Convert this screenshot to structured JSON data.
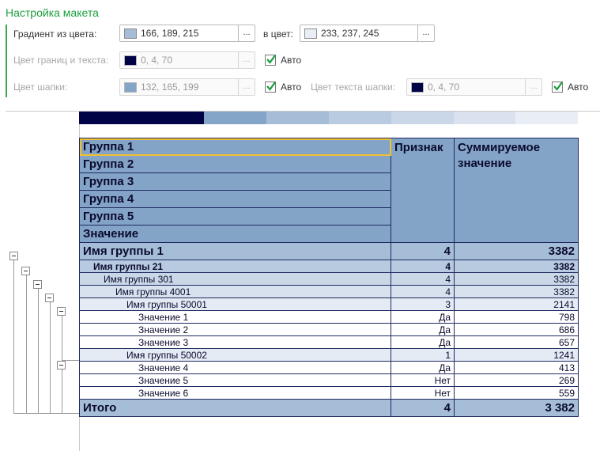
{
  "settings": {
    "title": "Настройка макета",
    "gradient_from_label": "Градиент из цвета:",
    "gradient_from_value": "166, 189, 215",
    "gradient_from_color": "#a6bdd7",
    "gradient_to_label": "в цвет:",
    "gradient_to_value": "233, 237, 245",
    "gradient_to_color": "#e9edf5",
    "border_text_label": "Цвет границ и текста:",
    "border_text_value": "0, 4, 70",
    "border_text_color": "#000446",
    "header_color_label": "Цвет шапки:",
    "header_color_value": "132, 165, 199",
    "header_color_color": "#84a5c7",
    "header_text_label": "Цвет текста шапки:",
    "header_text_value": "0, 4, 70",
    "header_text_color": "#000446",
    "dots": "...",
    "auto_label": "Авто",
    "auto_checked": true
  },
  "gradient_bar": [
    "#000446",
    "#84a5c7",
    "#a6bdd7",
    "#b9cbe0",
    "#cad7e8",
    "#d9e2ee",
    "#e9edf5"
  ],
  "table": {
    "header": {
      "groups": [
        "Группа 1",
        "Группа 2",
        "Группа 3",
        "Группа 4",
        "Группа 5",
        "Значение"
      ],
      "col_sign": "Признак",
      "col_sum": "Суммируемое значение"
    },
    "rows": [
      {
        "name": "Имя группы 1",
        "sign": "4",
        "sum": "3382"
      },
      {
        "name": "Имя группы 21",
        "sign": "4",
        "sum": "3382"
      },
      {
        "name": "Имя группы 301",
        "sign": "4",
        "sum": "3382"
      },
      {
        "name": "Имя группы 4001",
        "sign": "4",
        "sum": "3382"
      },
      {
        "name": "Имя группы 50001",
        "sign": "3",
        "sum": "2141"
      },
      {
        "name": "Значение 1",
        "sign": "Да",
        "sum": "798"
      },
      {
        "name": "Значение 2",
        "sign": "Да",
        "sum": "686"
      },
      {
        "name": "Значение 3",
        "sign": "Да",
        "sum": "657"
      },
      {
        "name": "Имя группы 50002",
        "sign": "1",
        "sum": "1241"
      },
      {
        "name": "Значение 4",
        "sign": "Да",
        "sum": "413"
      },
      {
        "name": "Значение 5",
        "sign": "Нет",
        "sum": "269"
      },
      {
        "name": "Значение 6",
        "sign": "Нет",
        "sum": "559"
      }
    ],
    "total": {
      "name": "Итого",
      "sign": "4",
      "sum": "3 382"
    }
  }
}
